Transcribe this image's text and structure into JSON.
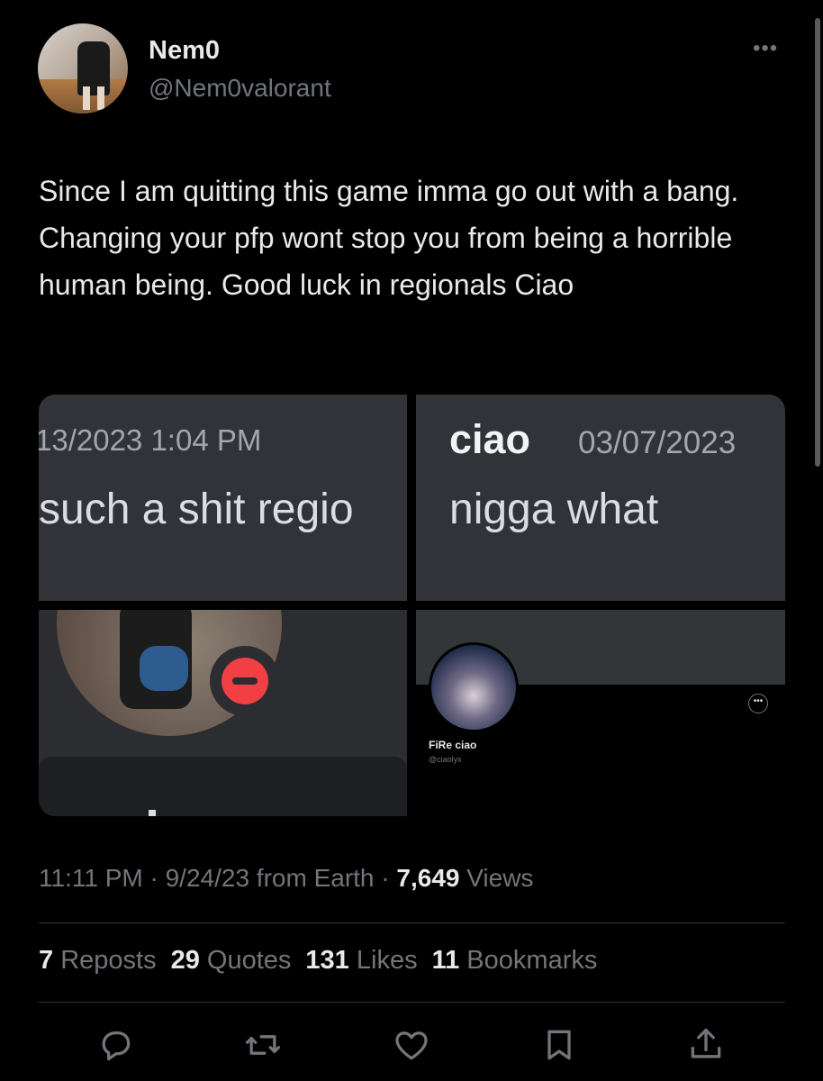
{
  "author": {
    "name": "Nem0",
    "handle": "@Nem0valorant"
  },
  "tweet": {
    "text": "Since I am quitting this game imma go out with a bang. Changing your pfp wont stop you from being a horrible human being. Good luck in regionals Ciao"
  },
  "media": {
    "tile1": {
      "timestamp": "13/2023 1:04 PM",
      "message": "such a shit regio"
    },
    "tile2": {
      "username": "ciao",
      "timestamp": "03/07/2023",
      "message": "nigga what"
    },
    "tile4": {
      "display_name": "FiRe ciao",
      "handle": "@ciaolyx"
    }
  },
  "meta": {
    "time": "11:11 PM",
    "sep1": " · ",
    "date": "9/24/23",
    "source": " from Earth",
    "sep2": " · ",
    "views_count": "7,649",
    "views_label": " Views"
  },
  "stats": {
    "reposts_count": "7",
    "reposts_label": " Reposts",
    "quotes_count": "29",
    "quotes_label": " Quotes",
    "likes_count": "131",
    "likes_label": " Likes",
    "bookmarks_count": "11",
    "bookmarks_label": " Bookmarks"
  },
  "icons": {
    "more": "more-icon",
    "reply": "reply-icon",
    "repost": "repost-icon",
    "like": "heart-icon",
    "bookmark": "bookmark-icon",
    "share": "share-icon"
  },
  "colors": {
    "background": "#000000",
    "text_primary": "#e7e9ea",
    "text_secondary": "#71767b",
    "discord_bg": "#313338",
    "dnd_red": "#f23f43"
  }
}
